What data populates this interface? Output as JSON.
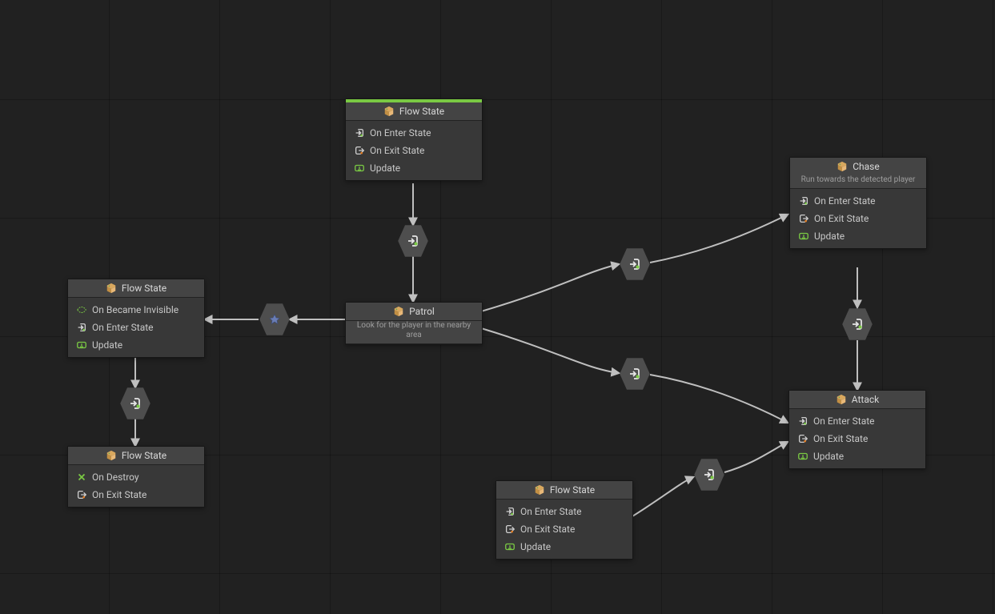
{
  "nodes": {
    "start": {
      "title": "Flow State",
      "rows": [
        "On Enter State",
        "On Exit State",
        "Update"
      ]
    },
    "patrol": {
      "title": "Patrol",
      "subtitle": "Look for the player in the nearby area"
    },
    "chase": {
      "title": "Chase",
      "subtitle": "Run towards the detected player",
      "rows": [
        "On Enter State",
        "On Exit State",
        "Update"
      ]
    },
    "attack": {
      "title": "Attack",
      "rows": [
        "On Enter State",
        "On Exit State",
        "Update"
      ]
    },
    "bottomFlow": {
      "title": "Flow State",
      "rows": [
        "On Enter State",
        "On Exit State",
        "Update"
      ]
    },
    "leftFlow1": {
      "title": "Flow State",
      "rows": [
        "On Became Invisible",
        "On Enter State",
        "Update"
      ]
    },
    "leftFlow2": {
      "title": "Flow State",
      "rows": [
        "On Destroy",
        "On Exit State"
      ]
    }
  },
  "transitions": {
    "t_start_patrol": "transition",
    "t_patrol_left": "any-transition",
    "t_patrol_chase": "transition",
    "t_patrol_attack": "transition",
    "t_chase_attack": "transition",
    "t_bottom_attack": "transition-selected",
    "t_left1_left2": "transition"
  },
  "icons": {
    "box": "box-icon",
    "enter": "enter-state-icon",
    "exit": "exit-state-icon",
    "update": "update-icon",
    "invisible": "became-invisible-icon",
    "destroy": "destroy-icon"
  }
}
